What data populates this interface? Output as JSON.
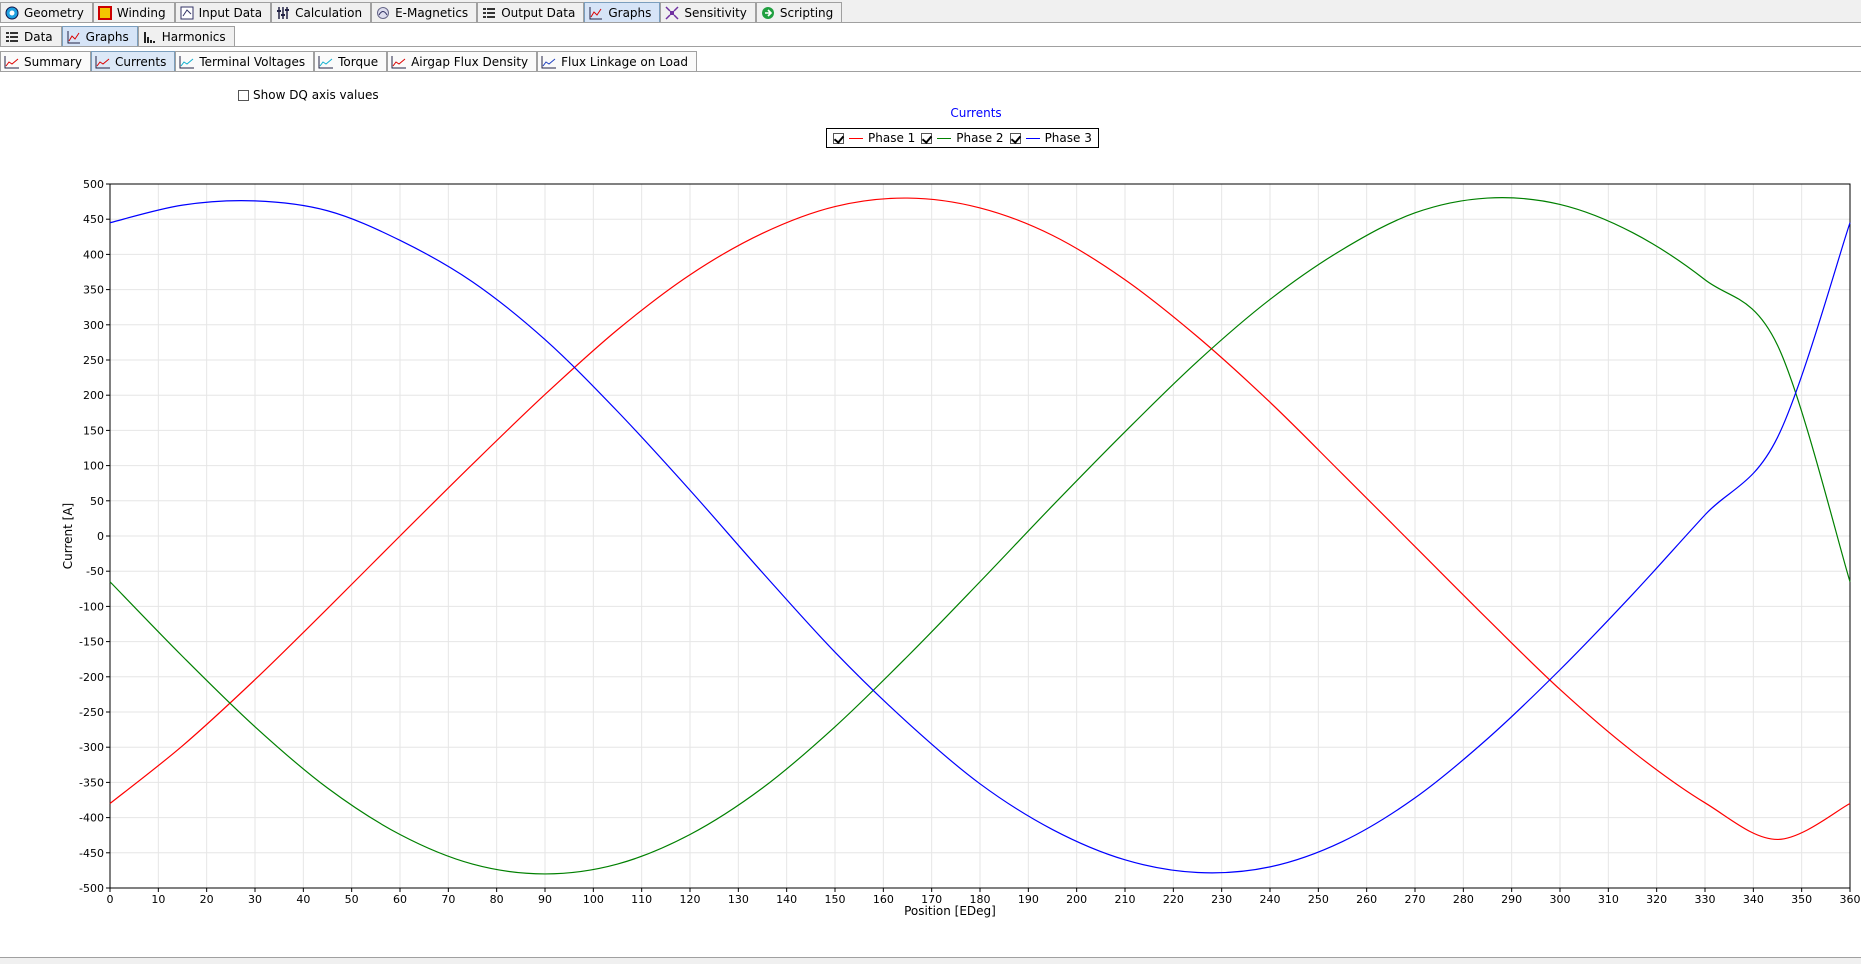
{
  "main_tabs": [
    {
      "label": "Geometry",
      "icon": "geometry-icon",
      "active": false
    },
    {
      "label": "Winding",
      "icon": "winding-icon",
      "active": false
    },
    {
      "label": "Input Data",
      "icon": "input-data-icon",
      "active": false
    },
    {
      "label": "Calculation",
      "icon": "calculation-icon",
      "active": false
    },
    {
      "label": "E-Magnetics",
      "icon": "emagnetics-icon",
      "active": false
    },
    {
      "label": "Output Data",
      "icon": "output-data-icon",
      "active": false
    },
    {
      "label": "Graphs",
      "icon": "graphs-icon",
      "active": true
    },
    {
      "label": "Sensitivity",
      "icon": "sensitivity-icon",
      "active": false
    },
    {
      "label": "Scripting",
      "icon": "scripting-icon",
      "active": false
    }
  ],
  "sub_tabs": [
    {
      "label": "Data",
      "icon": "data-icon",
      "active": false
    },
    {
      "label": "Graphs",
      "icon": "graphs-icon",
      "active": true
    },
    {
      "label": "Harmonics",
      "icon": "harmonics-icon",
      "active": false
    }
  ],
  "graph_tabs": [
    {
      "label": "Summary",
      "active": false
    },
    {
      "label": "Currents",
      "active": true
    },
    {
      "label": "Terminal Voltages",
      "active": false
    },
    {
      "label": "Torque",
      "active": false
    },
    {
      "label": "Airgap Flux Density",
      "active": false
    },
    {
      "label": "Flux Linkage on Load",
      "active": false
    }
  ],
  "dq_checkbox": {
    "label": "Show DQ axis values",
    "checked": false
  },
  "colors": {
    "phase1": "#ff0000",
    "phase2": "#008000",
    "phase3": "#0000ff",
    "title": "#0000ff",
    "grid": "#e6e6e6"
  },
  "chart_data": {
    "type": "line",
    "title": "Currents",
    "xlabel": "Position [EDeg]",
    "ylabel": "Current [A]",
    "xlim": [
      0,
      360
    ],
    "ylim": [
      -500,
      500
    ],
    "xticks": [
      0,
      10,
      20,
      30,
      40,
      50,
      60,
      70,
      80,
      90,
      100,
      110,
      120,
      130,
      140,
      150,
      160,
      170,
      180,
      190,
      200,
      210,
      220,
      230,
      240,
      250,
      260,
      270,
      280,
      290,
      300,
      310,
      320,
      330,
      340,
      350,
      360
    ],
    "yticks": [
      500,
      450,
      400,
      350,
      300,
      250,
      200,
      150,
      100,
      50,
      0,
      -50,
      -100,
      -150,
      -200,
      -250,
      -300,
      -350,
      -400,
      -450,
      -500
    ],
    "grid": true,
    "legend_position": "top-center",
    "series": [
      {
        "name": "Phase 1",
        "checked": true,
        "x": [
          0,
          15,
          30,
          45,
          60,
          75,
          90,
          105,
          120,
          135,
          150,
          165,
          180,
          195,
          210,
          225,
          240,
          255,
          270,
          285,
          300,
          315,
          330,
          345,
          360
        ],
        "y": [
          -380,
          -298,
          -204,
          -103,
          0,
          102,
          201,
          293,
          371,
          430,
          468,
          480,
          466,
          427,
          364,
          283,
          190,
          88,
          -15,
          -118,
          -218,
          -306,
          -379,
          -431,
          -380
        ]
      },
      {
        "name": "Phase 2",
        "checked": true,
        "x": [
          0,
          15,
          30,
          45,
          60,
          75,
          90,
          105,
          120,
          135,
          150,
          165,
          180,
          195,
          210,
          225,
          240,
          255,
          270,
          285,
          300,
          315,
          330,
          345,
          360
        ],
        "y": [
          -65,
          -171,
          -271,
          -358,
          -424,
          -466,
          -480,
          -466,
          -424,
          -358,
          -271,
          -171,
          -65,
          43,
          148,
          248,
          336,
          407,
          459,
          480,
          471,
          431,
          364,
          271,
          -65
        ]
      },
      {
        "name": "Phase 3",
        "checked": true,
        "x": [
          0,
          15,
          30,
          45,
          60,
          75,
          90,
          105,
          120,
          135,
          150,
          165,
          180,
          195,
          210,
          225,
          240,
          255,
          270,
          285,
          300,
          315,
          330,
          345,
          360
        ],
        "y": [
          445,
          470,
          476,
          462,
          420,
          361,
          279,
          177,
          65,
          -52,
          -165,
          -265,
          -352,
          -417,
          -460,
          -478,
          -470,
          -434,
          -372,
          -288,
          -190,
          -83,
          30,
          140,
          445
        ]
      }
    ]
  }
}
